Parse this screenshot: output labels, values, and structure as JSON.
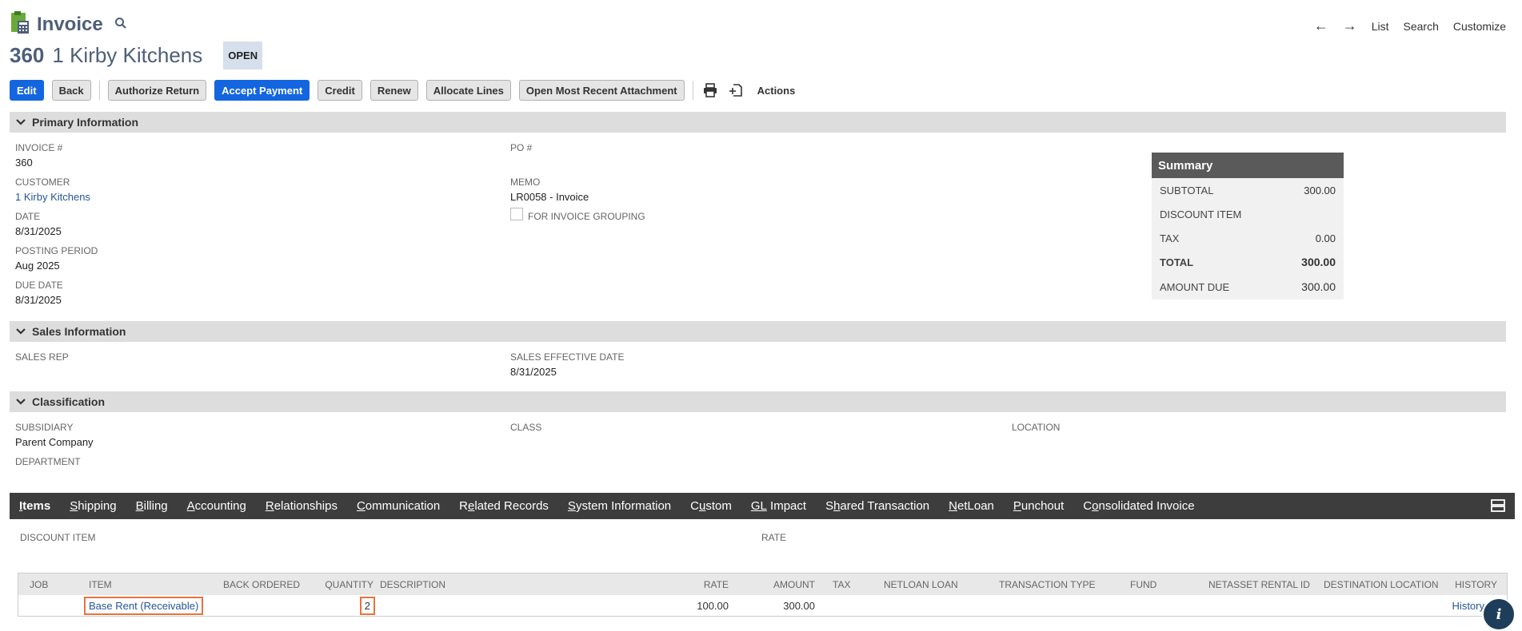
{
  "header": {
    "title": "Invoice",
    "record_number": "360",
    "record_name": "1 Kirby Kitchens",
    "status": "OPEN",
    "nav": {
      "back_arrow": "←",
      "forward_arrow": "→",
      "list": "List",
      "search": "Search",
      "customize": "Customize"
    }
  },
  "toolbar": {
    "edit": "Edit",
    "back": "Back",
    "authorize_return": "Authorize Return",
    "accept_payment": "Accept Payment",
    "credit": "Credit",
    "renew": "Renew",
    "allocate_lines": "Allocate Lines",
    "open_attachment": "Open Most Recent Attachment",
    "actions": "Actions"
  },
  "primary": {
    "section_label": "Primary Information",
    "invoice_no_label": "INVOICE #",
    "invoice_no": "360",
    "customer_label": "CUSTOMER",
    "customer": "1 Kirby Kitchens",
    "date_label": "DATE",
    "date": "8/31/2025",
    "posting_period_label": "POSTING PERIOD",
    "posting_period": "Aug 2025",
    "due_date_label": "DUE DATE",
    "due_date": "8/31/2025",
    "po_label": "PO #",
    "memo_label": "MEMO",
    "memo": "LR0058 - Invoice",
    "invoice_grouping_label": "FOR INVOICE GROUPING"
  },
  "summary": {
    "title": "Summary",
    "subtotal_label": "SUBTOTAL",
    "subtotal": "300.00",
    "discount_label": "DISCOUNT ITEM",
    "tax_label": "TAX",
    "tax": "0.00",
    "total_label": "TOTAL",
    "total": "300.00",
    "amount_due_label": "AMOUNT DUE",
    "amount_due": "300.00"
  },
  "sales": {
    "section_label": "Sales Information",
    "sales_rep_label": "SALES REP",
    "effective_date_label": "SALES EFFECTIVE DATE",
    "effective_date": "8/31/2025"
  },
  "classification": {
    "section_label": "Classification",
    "subsidiary_label": "SUBSIDIARY",
    "subsidiary": "Parent Company",
    "class_label": "CLASS",
    "location_label": "LOCATION",
    "department_label": "DEPARTMENT"
  },
  "tabs": [
    {
      "u": "I",
      "rest": "tems"
    },
    {
      "u": "S",
      "rest": "hipping"
    },
    {
      "u": "B",
      "rest": "illing"
    },
    {
      "u": "A",
      "rest": "ccounting"
    },
    {
      "u": "R",
      "rest": "elationships"
    },
    {
      "u": "C",
      "rest": "ommunication"
    },
    {
      "pre": "R",
      "u": "e",
      "rest": "lated Records"
    },
    {
      "u": "S",
      "rest": "ystem Information"
    },
    {
      "pre": "C",
      "u": "u",
      "rest": "stom"
    },
    {
      "u": "GL",
      "rest": " Impact"
    },
    {
      "pre": "S",
      "u": "h",
      "rest": "ared Transaction"
    },
    {
      "u": "N",
      "rest": "etLoan"
    },
    {
      "u": "P",
      "rest": "unchout"
    },
    {
      "pre": "C",
      "u": "o",
      "rest": "nsolidated Invoice"
    }
  ],
  "items": {
    "discount_item_label": "DISCOUNT ITEM",
    "rate_label": "RATE",
    "columns": {
      "job": "JOB",
      "item": "ITEM",
      "back_ordered": "BACK ORDERED",
      "quantity": "QUANTITY",
      "description": "DESCRIPTION",
      "rate": "RATE",
      "amount": "AMOUNT",
      "tax": "TAX",
      "netloan_loan": "NETLOAN LOAN",
      "transaction_type": "TRANSACTION TYPE",
      "fund": "FUND",
      "netasset_rental_id": "NETASSET RENTAL ID",
      "destination_location": "DESTINATION LOCATION",
      "history": "HISTORY"
    },
    "row": {
      "item": "Base Rent (Receivable)",
      "quantity": "2",
      "rate": "100.00",
      "amount": "300.00",
      "history": "History"
    }
  }
}
